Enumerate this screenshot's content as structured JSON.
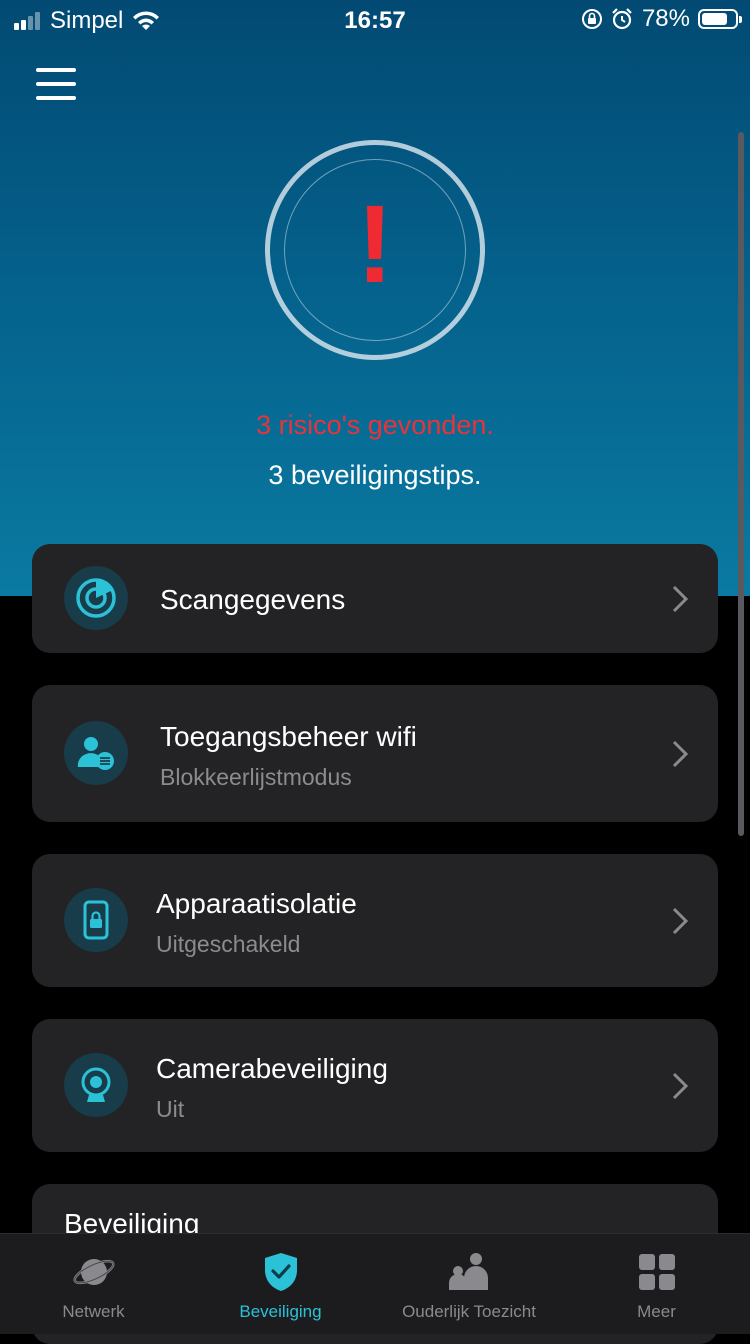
{
  "status_bar": {
    "carrier": "Simpel",
    "time": "16:57",
    "battery_percent": "78%",
    "battery_level": 0.78
  },
  "header": {
    "risk_text": "3 risico's gevonden.",
    "tips_text": "3 beveiligingstips."
  },
  "cards": [
    {
      "title": "Scangegevens",
      "subtitle": "",
      "icon": "radar-icon"
    },
    {
      "title": "Toegangsbeheer wifi",
      "subtitle": "Blokkeerlijstmodus",
      "icon": "user-list-icon"
    },
    {
      "title": "Apparaatisolatie",
      "subtitle": "Uitgeschakeld",
      "icon": "phone-lock-icon"
    },
    {
      "title": "Camerabeveiliging",
      "subtitle": "Uit",
      "icon": "webcam-icon"
    }
  ],
  "partial_card": {
    "text": "Beveiliging"
  },
  "tabbar": {
    "tabs": [
      {
        "label": "Netwerk",
        "icon": "planet-icon"
      },
      {
        "label": "Beveiliging",
        "icon": "shield-check-icon",
        "active": true
      },
      {
        "label": "Ouderlijk Toezicht",
        "icon": "family-icon"
      },
      {
        "label": "Meer",
        "icon": "grid-icon"
      }
    ]
  },
  "colors": {
    "accent": "#2bc2d8",
    "risk": "#e8333b",
    "card_bg": "#232325",
    "hero_top": "#024a73",
    "hero_bottom": "#0a7aa2"
  }
}
